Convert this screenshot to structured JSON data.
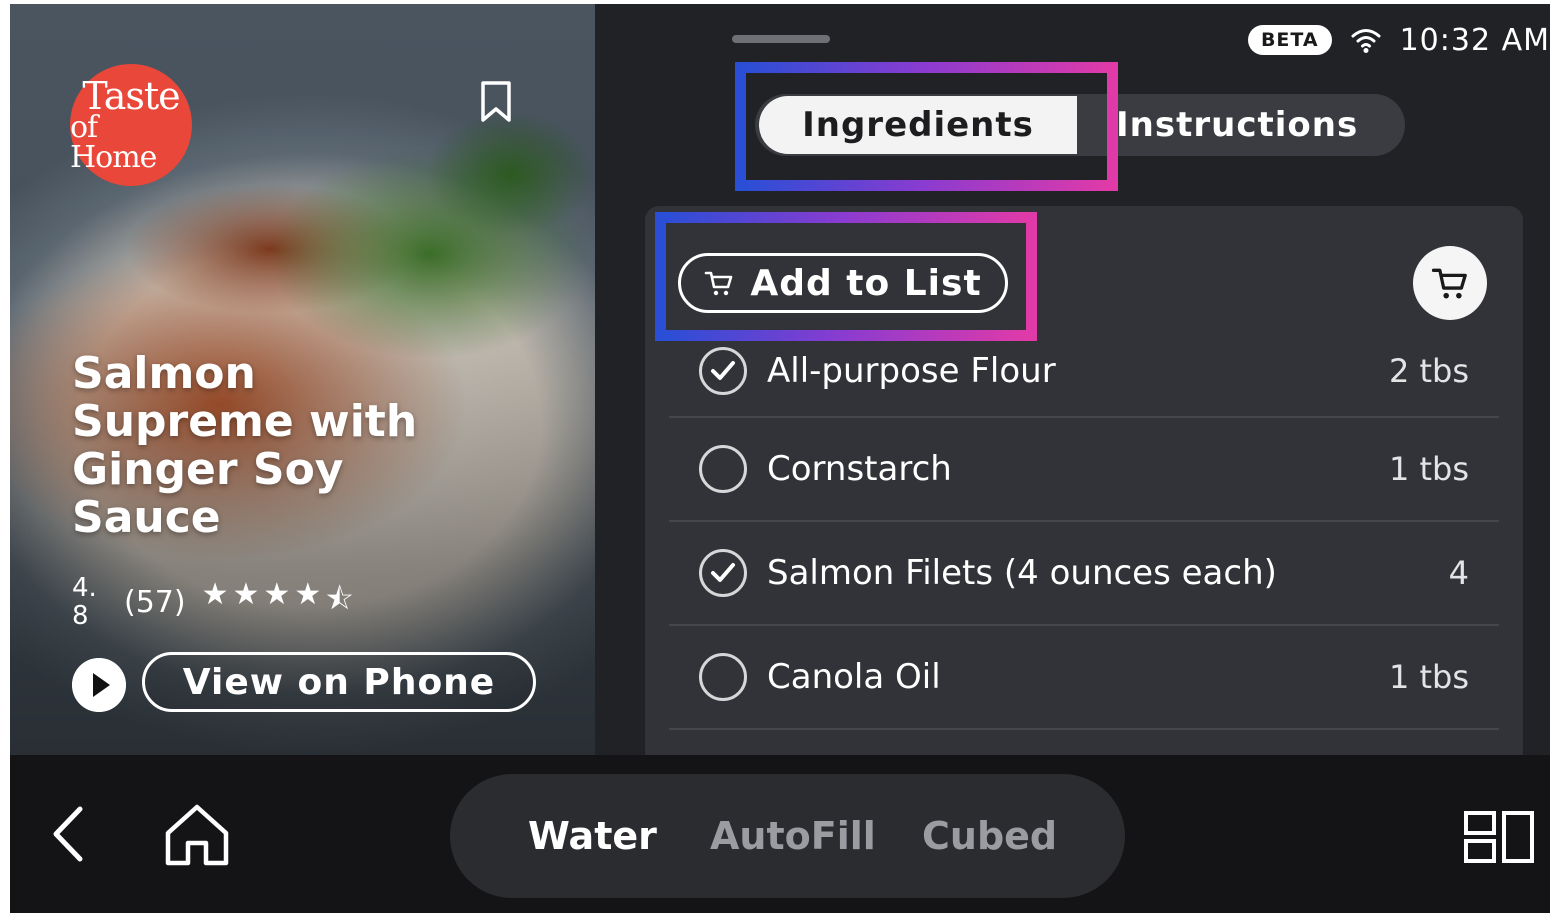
{
  "hero": {
    "logo_line1": "Taste",
    "logo_line2": "of Home",
    "title": "Salmon Supreme with Ginger Soy Sauce",
    "rating_value": "4.8",
    "rating_count": "(57)",
    "stars": 4.5,
    "view_phone_label": "View on Phone"
  },
  "status": {
    "beta_label": "BETA",
    "time": "10:32 AM"
  },
  "tabs": {
    "ingredients_label": "Ingredients",
    "instructions_label": "Instructions",
    "active": "Ingredients"
  },
  "ingredients": {
    "add_to_list_label": "Add to List",
    "items": [
      {
        "name": "All-purpose Flour",
        "qty": "2 tbs",
        "checked": true
      },
      {
        "name": "Cornstarch",
        "qty": "1 tbs",
        "checked": false
      },
      {
        "name": "Salmon Filets (4 ounces each)",
        "qty": "4",
        "checked": true
      },
      {
        "name": "Canola Oil",
        "qty": "1 tbs",
        "checked": false
      }
    ]
  },
  "bottom_nav": {
    "items": [
      "Water",
      "AutoFill",
      "Cubed"
    ],
    "active": "Water"
  },
  "icons": {
    "bookmark": "bookmark-icon",
    "wifi": "wifi-icon",
    "cart": "cart-icon",
    "check": "check-icon",
    "back": "back-arrow-icon",
    "home": "home-icon",
    "apps": "apps-icon",
    "play": "play-icon"
  },
  "colors": {
    "logo_red": "#e8473a",
    "highlight_start": "#2b4ed6",
    "highlight_end": "#e03aa8",
    "panel_bg": "#212226",
    "card_bg": "#323338"
  }
}
